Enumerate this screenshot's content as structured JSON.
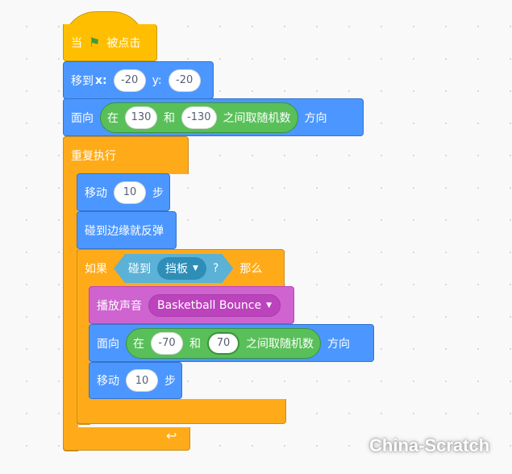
{
  "blocks": {
    "hat": {
      "when": "当",
      "clicked": "被点击",
      "icon": "green-flag-icon"
    },
    "goto": {
      "label": "移到",
      "x_label": "x:",
      "x": "-20",
      "y_label": "y:",
      "y": "-20"
    },
    "point1": {
      "label": "面向",
      "op_in": "在",
      "from": "130",
      "and": "和",
      "to": "-130",
      "op_tail": "之间取随机数",
      "suffix": "方向"
    },
    "forever": {
      "label": "重复执行",
      "icon": "loop-arrow-icon"
    },
    "move1": {
      "label": "移动",
      "steps": "10",
      "suffix": "步"
    },
    "bounce": {
      "label": "碰到边缘就反弹"
    },
    "if": {
      "label": "如果",
      "then": "那么",
      "cond_label": "碰到",
      "cond_target": "挡板",
      "cond_q": "?"
    },
    "sound": {
      "label": "播放声音",
      "value": "Basketball Bounce"
    },
    "point2": {
      "label": "面向",
      "op_in": "在",
      "from": "-70",
      "and": "和",
      "to": "70",
      "op_tail": "之间取随机数",
      "suffix": "方向"
    },
    "move2": {
      "label": "移动",
      "steps": "10",
      "suffix": "步"
    }
  },
  "watermark": "China-Scratch",
  "colors": {
    "motion": "#4C97FF",
    "events": "#FFBF00",
    "control": "#FFAB19",
    "operators": "#59C059",
    "sound": "#CF63CF",
    "sensing": "#5CB1D6"
  }
}
